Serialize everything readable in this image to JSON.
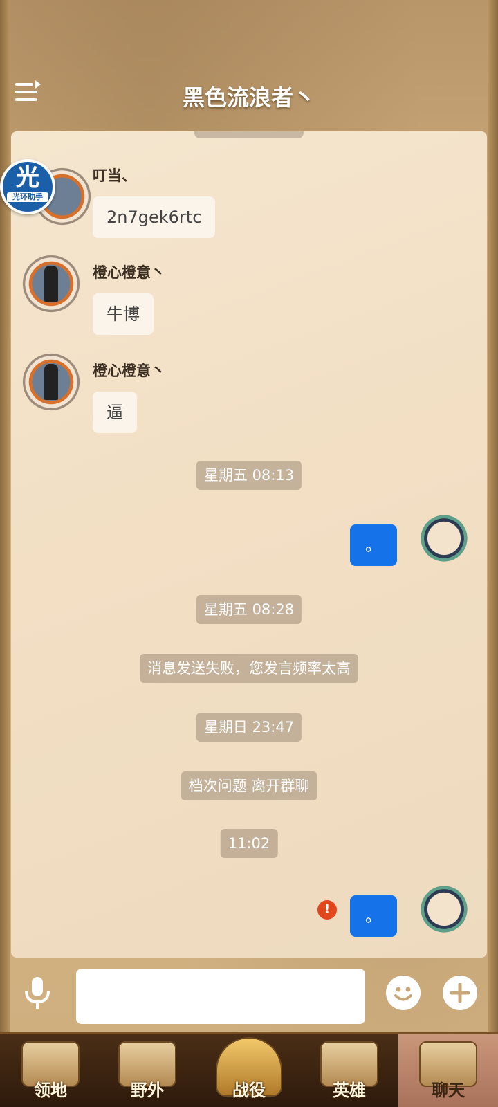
{
  "header": {
    "title": "黑色流浪者丶"
  },
  "badge": {
    "big": "光",
    "small": "光环助手"
  },
  "messages": [
    {
      "sender": "叮当、",
      "text": "2n7gek6rtc"
    },
    {
      "sender": "橙心橙意丶",
      "text": "牛博"
    },
    {
      "sender": "橙心橙意丶",
      "text": "逼"
    }
  ],
  "timeline": [
    {
      "text": "星期五 08:13"
    },
    {
      "text": "。"
    },
    {
      "text": "星期五 08:28"
    },
    {
      "text": "消息发送失败，您发言频率太高"
    },
    {
      "text": "星期日 23:47"
    },
    {
      "text": "档次问题 离开群聊"
    },
    {
      "text": "11:02"
    },
    {
      "text": "。"
    }
  ],
  "failed_icon": "!",
  "input": {
    "placeholder": ""
  },
  "icons": {
    "menu": "menu-icon",
    "mic": "microphone-icon",
    "emoji": "smiley-icon",
    "plus": "plus-icon"
  },
  "nav": [
    {
      "label": "领地",
      "active": false
    },
    {
      "label": "野外",
      "active": false
    },
    {
      "label": "战役",
      "active": false
    },
    {
      "label": "英雄",
      "active": false
    },
    {
      "label": "聊天",
      "active": true
    }
  ],
  "colors": {
    "self_bubble": "#1572e8",
    "fail": "#e2461c",
    "panel": "#f5e6cf"
  }
}
